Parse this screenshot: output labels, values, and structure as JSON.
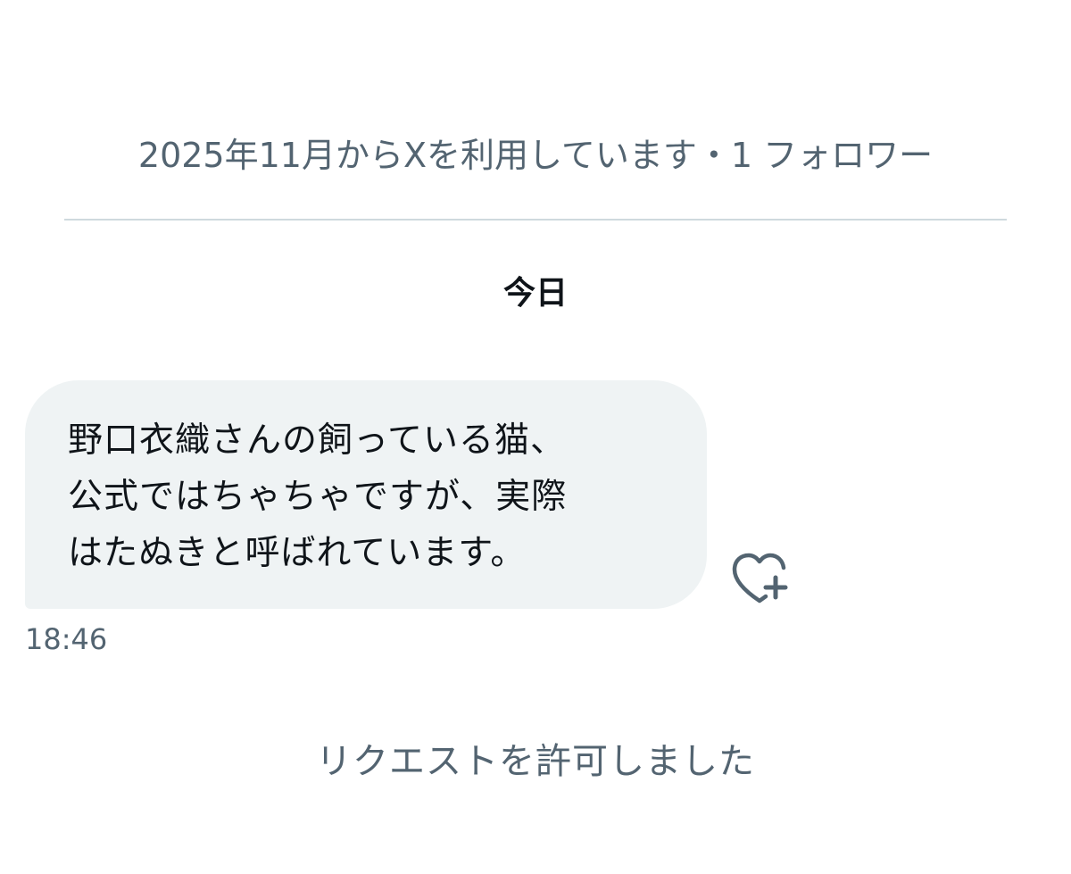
{
  "profile": {
    "meta_text": "2025年11月からXを利用しています・1 フォロワー"
  },
  "conversation": {
    "date_separator": "今日",
    "messages": [
      {
        "text": "野口衣織さんの飼っている猫、\n公式ではちゃちゃですが、実際\nはたぬきと呼ばれています。",
        "time": "18:46",
        "reaction_icon": "heart-plus-icon"
      }
    ],
    "system_message": "リクエストを許可しました"
  },
  "colors": {
    "secondary_text": "#536471",
    "primary_text": "#0f1419",
    "bubble_background": "#eff3f4",
    "divider": "#cfd9de"
  }
}
